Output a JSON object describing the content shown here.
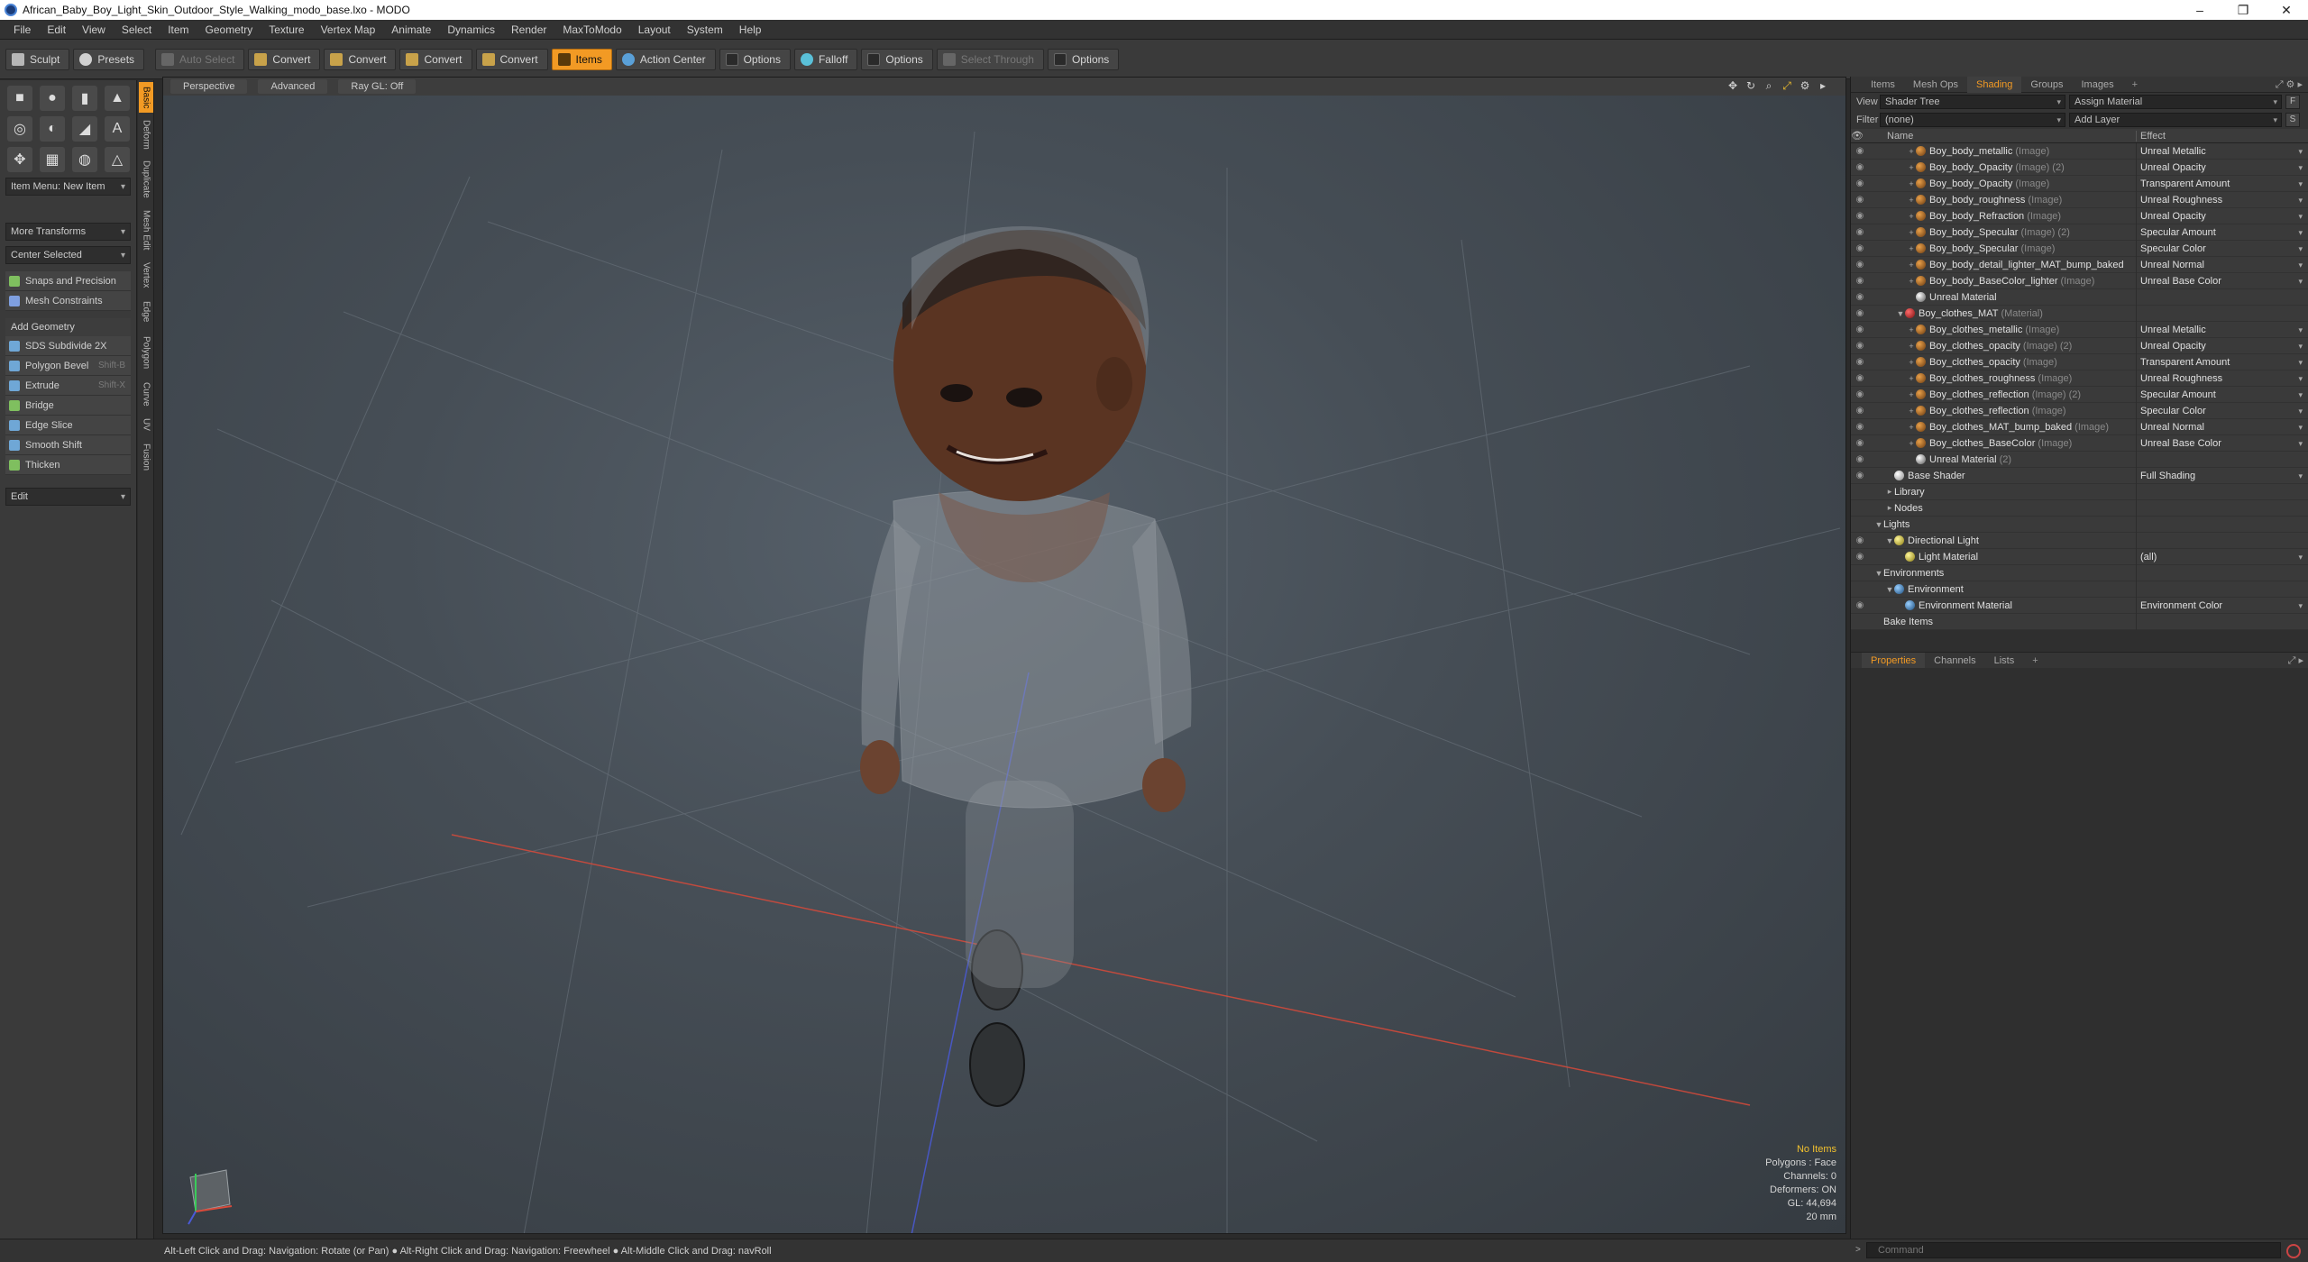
{
  "window": {
    "title": "African_Baby_Boy_Light_Skin_Outdoor_Style_Walking_modo_base.lxo - MODO",
    "minimize": "–",
    "maximize": "❐",
    "close": "✕"
  },
  "menu": [
    "File",
    "Edit",
    "View",
    "Select",
    "Item",
    "Geometry",
    "Texture",
    "Vertex Map",
    "Animate",
    "Dynamics",
    "Render",
    "MaxToModo",
    "Layout",
    "System",
    "Help"
  ],
  "toolbar": {
    "sculpt": "Sculpt",
    "presets": "Presets",
    "auto_select": "Auto Select",
    "convert1": "Convert",
    "convert2": "Convert",
    "convert3": "Convert",
    "convert4": "Convert",
    "items": "Items",
    "action_center": "Action Center",
    "options1": "Options",
    "falloff": "Falloff",
    "options2": "Options",
    "select_through": "Select Through",
    "options3": "Options"
  },
  "left_panel": {
    "item_menu": "Item Menu: New Item",
    "more_transforms": "More Transforms",
    "center_selected": "Center Selected",
    "snaps": "Snaps and Precision",
    "mesh_constraints": "Mesh Constraints",
    "add_geometry": "Add Geometry",
    "tools": [
      {
        "label": "SDS Subdivide 2X",
        "shortcut": ""
      },
      {
        "label": "Polygon Bevel",
        "shortcut": "Shift-B"
      },
      {
        "label": "Extrude",
        "shortcut": "Shift-X"
      },
      {
        "label": "Bridge",
        "shortcut": ""
      },
      {
        "label": "Edge Slice",
        "shortcut": ""
      },
      {
        "label": "Smooth Shift",
        "shortcut": ""
      },
      {
        "label": "Thicken",
        "shortcut": ""
      }
    ],
    "edit": "Edit",
    "vtabs": [
      "Basic",
      "Deform",
      "Duplicate",
      "Mesh Edit",
      "Vertex",
      "Edge",
      "Polygon",
      "Curve",
      "UV",
      "Fusion"
    ]
  },
  "viewport": {
    "tabs": [
      "Perspective",
      "Advanced",
      "Ray GL: Off"
    ],
    "info": {
      "no_items": "No Items",
      "polygons": "Polygons : Face",
      "channels": "Channels: 0",
      "deformers": "Deformers: ON",
      "gl": "GL: 44,694",
      "scale": "20 mm"
    }
  },
  "status": {
    "hint": "Alt-Left Click and Drag: Navigation: Rotate (or Pan) ● Alt-Right Click and Drag: Navigation: Freewheel ● Alt-Middle Click and Drag: navRoll",
    "command_placeholder": "Command"
  },
  "right_panel": {
    "tabs": [
      "Items",
      "Mesh Ops",
      "Shading",
      "Groups",
      "Images"
    ],
    "view_label": "View",
    "view_value": "Shader Tree",
    "assign_material": "Assign Material",
    "filter_label": "Filter",
    "filter_value": "(none)",
    "add_layer": "Add Layer",
    "f_btn": "F",
    "s_btn": "S",
    "col_name": "Name",
    "col_effect": "Effect",
    "tree": [
      {
        "indent": 3,
        "icon": "img",
        "toggle": "+",
        "name": "Boy_body_metallic",
        "tag": "(Image)",
        "effect": "Unreal Metallic",
        "eye": true
      },
      {
        "indent": 3,
        "icon": "img",
        "toggle": "+",
        "name": "Boy_body_Opacity",
        "tag": "(Image) (2)",
        "effect": "Unreal Opacity",
        "eye": true
      },
      {
        "indent": 3,
        "icon": "img",
        "toggle": "+",
        "name": "Boy_body_Opacity",
        "tag": "(Image)",
        "effect": "Transparent Amount",
        "eye": true
      },
      {
        "indent": 3,
        "icon": "img",
        "toggle": "+",
        "name": "Boy_body_roughness",
        "tag": "(Image)",
        "effect": "Unreal Roughness",
        "eye": true
      },
      {
        "indent": 3,
        "icon": "img",
        "toggle": "+",
        "name": "Boy_body_Refraction",
        "tag": "(Image)",
        "effect": "Unreal Opacity",
        "eye": true
      },
      {
        "indent": 3,
        "icon": "img",
        "toggle": "+",
        "name": "Boy_body_Specular",
        "tag": "(Image) (2)",
        "effect": "Specular Amount",
        "eye": true
      },
      {
        "indent": 3,
        "icon": "img",
        "toggle": "+",
        "name": "Boy_body_Specular",
        "tag": "(Image)",
        "effect": "Specular Color",
        "eye": true
      },
      {
        "indent": 3,
        "icon": "img",
        "toggle": "+",
        "name": "Boy_body_detail_lighter_MAT_bump_baked",
        "tag": "",
        "effect": "Unreal Normal",
        "eye": true
      },
      {
        "indent": 3,
        "icon": "img",
        "toggle": "+",
        "name": "Boy_body_BaseColor_lighter",
        "tag": "(Image)",
        "effect": "Unreal Base Color",
        "eye": true
      },
      {
        "indent": 3,
        "icon": "um",
        "toggle": "",
        "name": "Unreal Material",
        "tag": "",
        "effect": "",
        "eye": true
      },
      {
        "indent": 2,
        "icon": "mat",
        "toggle": "▼",
        "name": "Boy_clothes_MAT",
        "tag": "(Material)",
        "effect": "",
        "eye": true
      },
      {
        "indent": 3,
        "icon": "img",
        "toggle": "+",
        "name": "Boy_clothes_metallic",
        "tag": "(Image)",
        "effect": "Unreal Metallic",
        "eye": true
      },
      {
        "indent": 3,
        "icon": "img",
        "toggle": "+",
        "name": "Boy_clothes_opacity",
        "tag": "(Image) (2)",
        "effect": "Unreal Opacity",
        "eye": true
      },
      {
        "indent": 3,
        "icon": "img",
        "toggle": "+",
        "name": "Boy_clothes_opacity",
        "tag": "(Image)",
        "effect": "Transparent Amount",
        "eye": true
      },
      {
        "indent": 3,
        "icon": "img",
        "toggle": "+",
        "name": "Boy_clothes_roughness",
        "tag": "(Image)",
        "effect": "Unreal Roughness",
        "eye": true
      },
      {
        "indent": 3,
        "icon": "img",
        "toggle": "+",
        "name": "Boy_clothes_reflection",
        "tag": "(Image) (2)",
        "effect": "Specular Amount",
        "eye": true
      },
      {
        "indent": 3,
        "icon": "img",
        "toggle": "+",
        "name": "Boy_clothes_reflection",
        "tag": "(Image)",
        "effect": "Specular Color",
        "eye": true
      },
      {
        "indent": 3,
        "icon": "img",
        "toggle": "+",
        "name": "Boy_clothes_MAT_bump_baked",
        "tag": "(Image)",
        "effect": "Unreal Normal",
        "eye": true
      },
      {
        "indent": 3,
        "icon": "img",
        "toggle": "+",
        "name": "Boy_clothes_BaseColor",
        "tag": "(Image)",
        "effect": "Unreal Base Color",
        "eye": true
      },
      {
        "indent": 3,
        "icon": "um",
        "toggle": "",
        "name": "Unreal Material",
        "tag": "(2)",
        "effect": "",
        "eye": true
      },
      {
        "indent": 1,
        "icon": "shader",
        "toggle": "",
        "name": "Base Shader",
        "tag": "",
        "effect": "Full Shading",
        "eye": true
      },
      {
        "indent": 1,
        "icon": "none",
        "toggle": "▸",
        "name": "Library",
        "tag": "",
        "effect": "",
        "eye": false
      },
      {
        "indent": 1,
        "icon": "none",
        "toggle": "▸",
        "name": "Nodes",
        "tag": "",
        "effect": "",
        "eye": false
      },
      {
        "indent": 0,
        "icon": "none",
        "toggle": "▼",
        "name": "Lights",
        "tag": "",
        "effect": "",
        "eye": false
      },
      {
        "indent": 1,
        "icon": "light",
        "toggle": "▼",
        "name": "Directional Light",
        "tag": "",
        "effect": "",
        "eye": true
      },
      {
        "indent": 2,
        "icon": "light",
        "toggle": "",
        "name": "Light Material",
        "tag": "",
        "effect": "(all)",
        "eye": true
      },
      {
        "indent": 0,
        "icon": "none",
        "toggle": "▼",
        "name": "Environments",
        "tag": "",
        "effect": "",
        "eye": false
      },
      {
        "indent": 1,
        "icon": "env",
        "toggle": "▼",
        "name": "Environment",
        "tag": "",
        "effect": "",
        "eye": false
      },
      {
        "indent": 2,
        "icon": "env",
        "toggle": "",
        "name": "Environment Material",
        "tag": "",
        "effect": "Environment Color",
        "eye": true
      },
      {
        "indent": 0,
        "icon": "none",
        "toggle": "",
        "name": "Bake Items",
        "tag": "",
        "effect": "",
        "eye": false
      }
    ],
    "props_tabs": [
      "Properties",
      "Channels",
      "Lists"
    ]
  }
}
